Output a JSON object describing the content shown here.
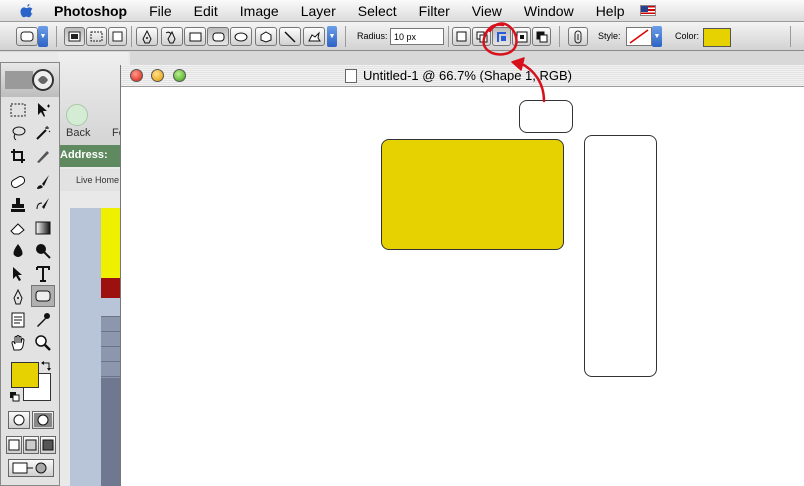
{
  "menubar": {
    "app": "Photoshop",
    "items": [
      "File",
      "Edit",
      "Image",
      "Layer",
      "Select",
      "Filter",
      "View",
      "Window",
      "Help"
    ]
  },
  "options": {
    "radius_label": "Radius:",
    "radius_value": "10 px",
    "style_label": "Style:",
    "color_label": "Color:",
    "color": "#e6d200"
  },
  "browser": {
    "back_label": "Back",
    "forward_label": "Fo",
    "address_label": "Address:",
    "favorite_label": "Live Home"
  },
  "tools": {
    "foreground_color": "#e6d200",
    "background_color": "#ffffff"
  },
  "document": {
    "title": "Untitled-1 @ 66.7% (Shape 1, RGB)"
  },
  "annotation_color": "#d8101c"
}
